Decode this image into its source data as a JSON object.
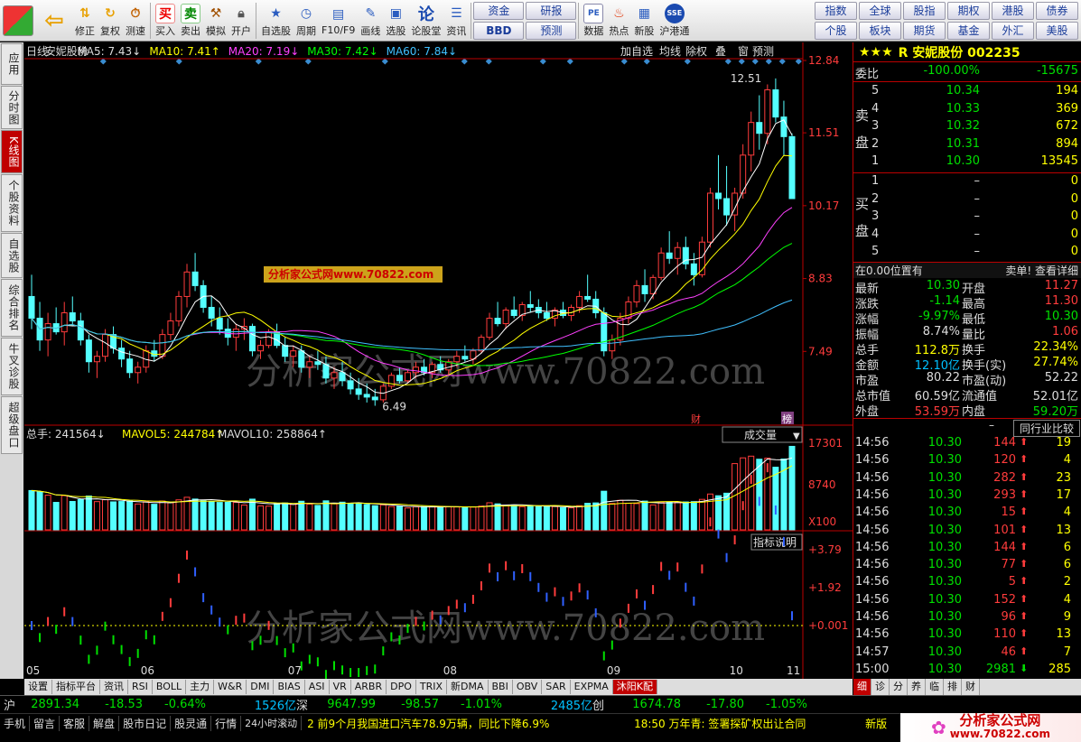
{
  "toolbar": {
    "buttons": [
      {
        "label": "",
        "icon": "windows-icon"
      },
      {
        "label": "",
        "icon": "back-arrow-icon"
      },
      {
        "label": "修正",
        "icon": "updown-arrows-icon"
      },
      {
        "label": "复权",
        "icon": "refresh-icon"
      },
      {
        "label": "测速",
        "icon": "clock-icon"
      },
      {
        "label": "买入",
        "icon": "buy-icon",
        "glyph": "买"
      },
      {
        "label": "卖出",
        "icon": "sell-icon",
        "glyph": "卖"
      },
      {
        "label": "模拟",
        "icon": "hammer-icon"
      },
      {
        "label": "开户",
        "icon": "lock-icon"
      },
      {
        "label": "自选股",
        "icon": "star-icon"
      },
      {
        "label": "周期",
        "icon": "cycle-icon"
      },
      {
        "label": "F10/F9",
        "icon": "f10-icon"
      },
      {
        "label": "画线",
        "icon": "pen-icon"
      },
      {
        "label": "选股",
        "icon": "select-icon"
      },
      {
        "label": "论股堂",
        "icon": "forum-icon",
        "glyph": "论"
      },
      {
        "label": "资讯",
        "icon": "news-icon"
      }
    ],
    "mid_buttons": [
      "资金",
      "研报",
      "BBD",
      "预测"
    ],
    "tool_buttons": [
      {
        "label": "数据",
        "icon": "pe-icon"
      },
      {
        "label": "热点",
        "icon": "hot-icon"
      },
      {
        "label": "新股",
        "icon": "newstock-icon"
      },
      {
        "label": "沪港通",
        "icon": "hk-icon"
      }
    ],
    "right_grid": [
      "指数",
      "全球",
      "股指",
      "期权",
      "港股",
      "债券",
      "个股",
      "板块",
      "期货",
      "基金",
      "外汇",
      "美股"
    ]
  },
  "sidenav": [
    "应用",
    "分时图",
    "K线图",
    "个股资料",
    "自选股",
    "综合排名",
    "牛叉诊股",
    "超级盘口"
  ],
  "sidenav_active": 2,
  "chart_header": {
    "period": "日线",
    "name": "安妮股份",
    "ma5": "MA5: 7.43↓",
    "ma10": "MA10: 7.41↑",
    "ma20": "MA20: 7.19↓",
    "ma30": "MA30: 7.42↓",
    "ma60": "MA60: 7.84↓",
    "buttons": [
      "加自选",
      "均线",
      "除权",
      "叠",
      "窗",
      "预测"
    ]
  },
  "chart_data": {
    "type": "candlestick",
    "title": "安妮股份 日线",
    "price_axis": [
      "12.84",
      "11.51",
      "10.17",
      "8.83",
      "7.49"
    ],
    "price_range": [
      6.2,
      12.84
    ],
    "high_label": "12.51",
    "low_label": "6.49",
    "x_labels": [
      "05",
      "06",
      "07",
      "08",
      "09",
      "10",
      "11"
    ],
    "ohlc": [
      [
        8.5,
        8.9,
        7.9,
        8.1
      ],
      [
        8.1,
        8.4,
        7.5,
        7.7
      ],
      [
        7.7,
        8.2,
        7.4,
        8.0
      ],
      [
        8.0,
        8.3,
        7.8,
        7.85
      ],
      [
        7.85,
        8.4,
        7.6,
        8.2
      ],
      [
        8.2,
        8.5,
        7.95,
        8.05
      ],
      [
        8.05,
        8.2,
        7.6,
        7.7
      ],
      [
        7.7,
        7.8,
        7.1,
        7.3
      ],
      [
        7.3,
        7.5,
        7.0,
        7.4
      ],
      [
        7.4,
        7.9,
        7.3,
        7.8
      ],
      [
        7.8,
        7.95,
        7.45,
        7.55
      ],
      [
        7.55,
        7.7,
        7.2,
        7.35
      ],
      [
        7.35,
        7.5,
        7.0,
        7.1
      ],
      [
        7.1,
        7.3,
        6.9,
        7.2
      ],
      [
        7.2,
        7.6,
        7.1,
        7.5
      ],
      [
        7.5,
        7.7,
        7.3,
        7.4
      ],
      [
        7.4,
        7.9,
        7.35,
        7.8
      ],
      [
        7.8,
        8.2,
        7.7,
        8.05
      ],
      [
        8.05,
        8.6,
        7.95,
        8.5
      ],
      [
        8.5,
        9.1,
        8.3,
        8.95
      ],
      [
        8.95,
        9.3,
        8.6,
        8.7
      ],
      [
        8.7,
        8.8,
        8.2,
        8.3
      ],
      [
        8.3,
        8.5,
        7.95,
        8.1
      ],
      [
        8.1,
        8.3,
        7.8,
        7.9
      ],
      [
        7.9,
        8.1,
        7.6,
        7.75
      ],
      [
        7.75,
        8.0,
        7.5,
        7.9
      ],
      [
        7.9,
        8.1,
        7.7,
        7.95
      ],
      [
        7.95,
        8.0,
        7.4,
        7.5
      ],
      [
        7.5,
        7.7,
        7.35,
        7.6
      ],
      [
        7.6,
        7.9,
        7.55,
        7.85
      ],
      [
        7.85,
        8.0,
        7.55,
        7.6
      ],
      [
        7.6,
        7.75,
        7.3,
        7.4
      ],
      [
        7.4,
        7.6,
        7.2,
        7.5
      ],
      [
        7.5,
        7.6,
        7.1,
        7.2
      ],
      [
        7.2,
        7.4,
        7.0,
        7.3
      ],
      [
        7.3,
        7.5,
        7.15,
        7.25
      ],
      [
        7.25,
        7.4,
        6.9,
        7.0
      ],
      [
        7.0,
        7.2,
        6.8,
        7.1
      ],
      [
        7.1,
        7.3,
        6.85,
        6.95
      ],
      [
        6.95,
        7.1,
        6.7,
        6.8
      ],
      [
        6.8,
        7.0,
        6.6,
        6.7
      ],
      [
        6.7,
        6.9,
        6.55,
        6.65
      ],
      [
        6.65,
        6.8,
        6.49,
        6.6
      ],
      [
        6.6,
        6.9,
        6.55,
        6.85
      ],
      [
        6.85,
        7.1,
        6.8,
        7.05
      ],
      [
        7.05,
        7.2,
        6.9,
        6.95
      ],
      [
        6.95,
        7.15,
        6.9,
        7.1
      ],
      [
        7.1,
        7.3,
        7.0,
        7.2
      ],
      [
        7.2,
        7.35,
        7.05,
        7.1
      ],
      [
        7.1,
        7.3,
        7.0,
        7.25
      ],
      [
        7.25,
        7.4,
        7.1,
        7.15
      ],
      [
        7.15,
        7.35,
        7.05,
        7.3
      ],
      [
        7.3,
        7.5,
        7.2,
        7.4
      ],
      [
        7.4,
        7.6,
        7.3,
        7.35
      ],
      [
        7.35,
        7.55,
        7.25,
        7.5
      ],
      [
        7.5,
        7.8,
        7.45,
        7.75
      ],
      [
        7.75,
        8.2,
        7.7,
        8.1
      ],
      [
        8.1,
        8.4,
        7.95,
        8.0
      ],
      [
        8.0,
        8.3,
        7.9,
        8.25
      ],
      [
        8.25,
        8.5,
        8.1,
        8.15
      ],
      [
        8.15,
        8.4,
        8.05,
        8.35
      ],
      [
        8.35,
        8.6,
        8.2,
        8.3
      ],
      [
        8.3,
        8.45,
        8.1,
        8.2
      ],
      [
        8.2,
        8.4,
        8.05,
        8.1
      ],
      [
        8.1,
        8.3,
        7.95,
        8.25
      ],
      [
        8.25,
        8.4,
        8.1,
        8.15
      ],
      [
        8.15,
        8.35,
        8.05,
        8.3
      ],
      [
        8.3,
        8.6,
        8.2,
        8.5
      ],
      [
        8.5,
        8.9,
        8.4,
        8.45
      ],
      [
        8.45,
        8.6,
        8.1,
        8.2
      ],
      [
        8.2,
        8.3,
        7.4,
        7.5
      ],
      [
        7.5,
        7.8,
        7.35,
        7.7
      ],
      [
        7.7,
        8.2,
        7.6,
        8.1
      ],
      [
        8.1,
        8.5,
        8.0,
        8.4
      ],
      [
        8.4,
        8.8,
        8.3,
        8.7
      ],
      [
        8.7,
        9.0,
        8.4,
        8.55
      ],
      [
        8.55,
        8.9,
        8.45,
        8.85
      ],
      [
        8.85,
        9.4,
        8.8,
        9.3
      ],
      [
        9.3,
        9.7,
        9.1,
        9.2
      ],
      [
        9.2,
        9.5,
        8.9,
        9.4
      ],
      [
        9.4,
        9.6,
        9.0,
        9.1
      ],
      [
        9.1,
        9.3,
        8.7,
        8.9
      ],
      [
        8.9,
        9.6,
        8.85,
        9.5
      ],
      [
        9.5,
        10.5,
        9.4,
        10.4
      ],
      [
        10.4,
        11.1,
        10.1,
        10.3
      ],
      [
        10.3,
        10.9,
        9.8,
        10.0
      ],
      [
        10.0,
        10.5,
        9.7,
        10.4
      ],
      [
        10.4,
        11.3,
        10.3,
        11.1
      ],
      [
        11.1,
        11.9,
        10.8,
        11.7
      ],
      [
        11.7,
        12.2,
        11.2,
        11.5
      ],
      [
        11.5,
        12.4,
        11.3,
        12.3
      ],
      [
        12.3,
        12.51,
        11.7,
        11.8
      ],
      [
        11.8,
        12.1,
        11.1,
        11.44
      ],
      [
        11.44,
        11.5,
        10.3,
        10.3
      ]
    ],
    "volume_axis": [
      "17301",
      "8740",
      "X100"
    ],
    "volume_header": {
      "total": "总手: 241564↓",
      "mavol5": "MAVOL5: 244784↑",
      "mavol10": "MAVOL10: 258864↑"
    },
    "volume_dropdown": "成交量",
    "indicator_axis": [
      "+3.79",
      "+1.92",
      "+0.001"
    ],
    "indicator_button": "指标说明",
    "markers": [
      "财",
      "榜"
    ]
  },
  "watermark": "分析家公式网www.70822.com",
  "watermark_small": "分析家公式网www.70822.com",
  "quote": {
    "stars": "★★★",
    "code_label": "R 安妮股份 002235",
    "weibi_label": "委比",
    "weibi": "-100.00%",
    "weicha": "-15675",
    "sell_label": "卖",
    "sell_label2": "盘",
    "sell": [
      [
        "5",
        "10.34",
        "194"
      ],
      [
        "4",
        "10.33",
        "369"
      ],
      [
        "3",
        "10.32",
        "672"
      ],
      [
        "2",
        "10.31",
        "894"
      ],
      [
        "1",
        "10.30",
        "13545"
      ]
    ],
    "buy_label": "买",
    "buy_label2": "盘",
    "buy": [
      [
        "1",
        "–",
        "0"
      ],
      [
        "2",
        "–",
        "0"
      ],
      [
        "3",
        "–",
        "0"
      ],
      [
        "4",
        "–",
        "0"
      ],
      [
        "5",
        "–",
        "0"
      ]
    ],
    "pos_text": "在0.00位置有",
    "detail_text": "卖单! 查看详细",
    "stats": [
      [
        "最新",
        "10.30",
        "开盘",
        "11.27"
      ],
      [
        "涨跌",
        "-1.14",
        "最高",
        "11.30"
      ],
      [
        "涨幅",
        "-9.97%",
        "最低",
        "10.30"
      ],
      [
        "振幅",
        "8.74%",
        "量比",
        "1.06"
      ],
      [
        "总手",
        "112.8万",
        "换手",
        "22.34%"
      ],
      [
        "金额",
        "12.10亿",
        "换手(实)",
        "27.74%"
      ],
      [
        "市盈",
        "80.22",
        "市盈(动)",
        "52.22"
      ],
      [
        "总市值",
        "60.59亿",
        "流通值",
        "52.01亿"
      ],
      [
        "外盘",
        "53.59万",
        "内盘",
        "59.20万"
      ]
    ],
    "compare_btn": "同行业比较",
    "ticks": [
      [
        "14:56",
        "10.30",
        "144",
        "19"
      ],
      [
        "14:56",
        "10.30",
        "120",
        "4"
      ],
      [
        "14:56",
        "10.30",
        "282",
        "23"
      ],
      [
        "14:56",
        "10.30",
        "293",
        "17"
      ],
      [
        "14:56",
        "10.30",
        "15",
        "4"
      ],
      [
        "14:56",
        "10.30",
        "101",
        "13"
      ],
      [
        "14:56",
        "10.30",
        "144",
        "6"
      ],
      [
        "14:56",
        "10.30",
        "77",
        "6"
      ],
      [
        "14:56",
        "10.30",
        "5",
        "2"
      ],
      [
        "14:56",
        "10.30",
        "152",
        "4"
      ],
      [
        "14:56",
        "10.30",
        "96",
        "9"
      ],
      [
        "14:56",
        "10.30",
        "110",
        "13"
      ],
      [
        "14:57",
        "10.30",
        "46",
        "7"
      ],
      [
        "15:00",
        "10.30",
        "2981",
        "285"
      ]
    ],
    "rtabs": [
      "细",
      "诊",
      "分",
      "养",
      "临",
      "排",
      "财"
    ]
  },
  "bottom_tabs": [
    "设置",
    "指标平台",
    "资讯",
    "RSI",
    "BOLL",
    "主力",
    "W&R",
    "DMI",
    "BIAS",
    "ASI",
    "VR",
    "ARBR",
    "DPO",
    "TRIX",
    "新DMA",
    "BBI",
    "OBV",
    "SAR",
    "EXPMA",
    "沐阳K配"
  ],
  "bottom_tab_active": 19,
  "index_bar": {
    "sh_label": "沪",
    "sh_val": "2891.34",
    "sh_chg": "-18.53",
    "sh_pct": "-0.64%",
    "sh_amt": "1526亿",
    "sz_label": "深",
    "sz_val": "9647.99",
    "sz_chg": "-98.57",
    "sz_pct": "-1.01%",
    "sz_amt": "2485亿",
    "cy_label": "创",
    "cy_val": "1674.78",
    "cy_chg": "-17.80",
    "cy_pct": "-1.05%"
  },
  "status": {
    "buttons": [
      "手机",
      "留言",
      "客服",
      "解盘",
      "股市日记",
      "股灵通",
      "行情",
      "24小时滚动"
    ],
    "news1": "2 前9个月我国进口汽车78.9万辆，同比下降6.9%",
    "news2": "18:50 万年青: 签署探矿权出让合同",
    "news3": "新版"
  },
  "logo_text": "分析家公式网",
  "logo_url": "www.70822.com"
}
